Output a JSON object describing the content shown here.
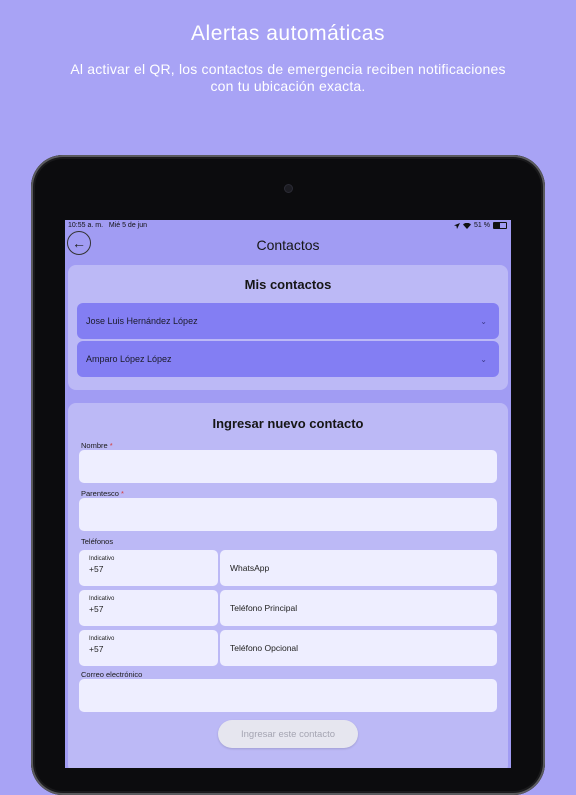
{
  "promo": {
    "title": "Alertas automáticas",
    "subtitle": "Al activar el QR, los contactos de emergencia reciben notificaciones con tu ubicación exacta."
  },
  "statusbar": {
    "time": "10:55 a. m.",
    "date": "Mié 5 de jun",
    "battery": "51 %",
    "battery_level": 0.51,
    "icons": [
      "location-icon",
      "wifi-icon",
      "battery-icon"
    ]
  },
  "header": {
    "back_icon": "arrow-left-icon",
    "back_glyph": "←",
    "title": "Contactos"
  },
  "my_contacts": {
    "title": "Mis contactos",
    "items": [
      {
        "name": "Jose Luis Hernández López",
        "chevron": "⌄"
      },
      {
        "name": "Amparo López López",
        "chevron": "⌄"
      }
    ]
  },
  "new_contact": {
    "title": "Ingresar nuevo contacto",
    "name_label": "Nombre",
    "relationship_label": "Parentesco",
    "required_mark": "*",
    "phones_label": "Teléfonos",
    "phones": [
      {
        "code_label": "Indicativo",
        "code": "+57",
        "placeholder": "WhatsApp"
      },
      {
        "code_label": "Indicativo",
        "code": "+57",
        "placeholder": "Teléfono Principal"
      },
      {
        "code_label": "Indicativo",
        "code": "+57",
        "placeholder": "Teléfono Opcional"
      }
    ],
    "email_label": "Correo electrónico",
    "submit_label": "Ingresar este contacto"
  },
  "colors": {
    "background": "#a8a3f5",
    "card": "#bcb9f6",
    "contact_row": "#837ef3",
    "input": "#eeeeff",
    "required": "#d63a3a"
  }
}
